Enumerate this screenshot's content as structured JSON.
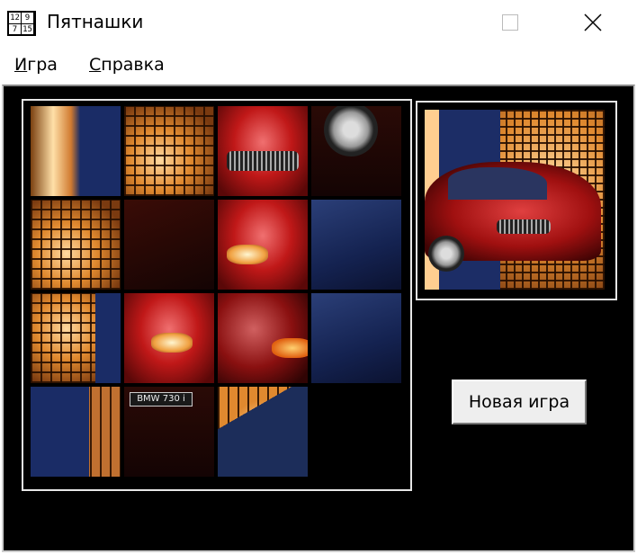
{
  "window": {
    "title": "Пятнашки",
    "icon_digits": [
      "12",
      "9",
      "7",
      "15"
    ]
  },
  "menu": [
    {
      "label": "Игра",
      "underline": "И",
      "rest": "гра"
    },
    {
      "label": "Справка",
      "underline": "С",
      "rest": "правка"
    }
  ],
  "board": {
    "rows": 4,
    "cols": 4,
    "empty_cell": [
      3,
      3
    ],
    "plate_text": "BMW 730 i"
  },
  "buttons": {
    "new_game": "Новая игра"
  }
}
